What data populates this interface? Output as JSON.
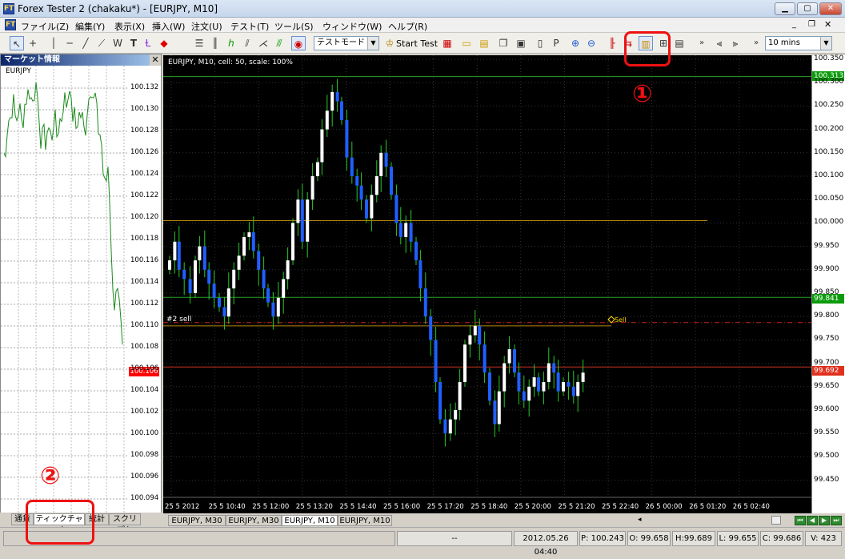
{
  "window": {
    "title": "Forex Tester 2  (chakaku*) - [EURJPY, M10]",
    "app_icon": "FT"
  },
  "menu": [
    "ファイル(Z)",
    "編集(Y)",
    "表示(X)",
    "挿入(W)",
    "注文(U)",
    "テスト(T)",
    "ツール(S)",
    "ウィンドウ(W)",
    "ヘルプ(R)"
  ],
  "toolbar": {
    "test_mode": "テストモード",
    "start_test": "Start Test",
    "timeframe": "10 mins"
  },
  "market_panel": {
    "title": "マーケット情報",
    "symbol": "EURJPY",
    "ticks": [
      "100.132",
      "100.130",
      "100.128",
      "100.126",
      "100.124",
      "100.122",
      "100.120",
      "100.118",
      "100.116",
      "100.114",
      "100.112",
      "100.110",
      "100.108",
      "100.106",
      "100.104",
      "100.102",
      "100.100",
      "100.098",
      "100.096",
      "100.094"
    ],
    "current_price": "100.106",
    "tabs": [
      "通貨",
      "ティックチャート",
      "統計",
      "スクリプト"
    ]
  },
  "chart": {
    "info": "EURJPY, M10, cell: 50, scale: 100%",
    "y_labels": [
      "100.350",
      "100.300",
      "100.250",
      "100.200",
      "100.150",
      "100.100",
      "100.050",
      "100.000",
      "99.950",
      "99.900",
      "99.850",
      "99.800",
      "99.750",
      "99.700",
      "99.650",
      "99.600",
      "99.550",
      "99.500",
      "99.450"
    ],
    "x_labels": [
      "25 5 2012",
      "25 5 10:40",
      "25 5 12:00",
      "25 5 13:20",
      "25 5 14:40",
      "25 5 16:00",
      "25 5 17:20",
      "25 5 18:40",
      "25 5 20:00",
      "25 5 21:20",
      "25 5 22:40",
      "26 5 00:00",
      "26 5 01:20",
      "26 5 02:40"
    ],
    "tag_top": "100.313",
    "tag_mid": "99.841",
    "tag_red": "99.692",
    "order_label": "#2 sell",
    "sell_marker": "Sell",
    "colors": {
      "bull": "#ffffff",
      "bear": "#1f5fff",
      "wick": "#28c828"
    }
  },
  "chart_tabs": [
    "EURJPY, M30",
    "EURJPY, M30",
    "EURJPY, M10",
    "EURJPY, M10"
  ],
  "status": {
    "dash": "--",
    "datetime": "2012.05.26 04:40",
    "p": "P: 100.243",
    "o": "O: 99.658",
    "h": "H:99.689",
    "l": "L: 99.655",
    "c": "C: 99.686",
    "v": "V: 423"
  },
  "annotations": {
    "one": "①",
    "two": "②"
  }
}
